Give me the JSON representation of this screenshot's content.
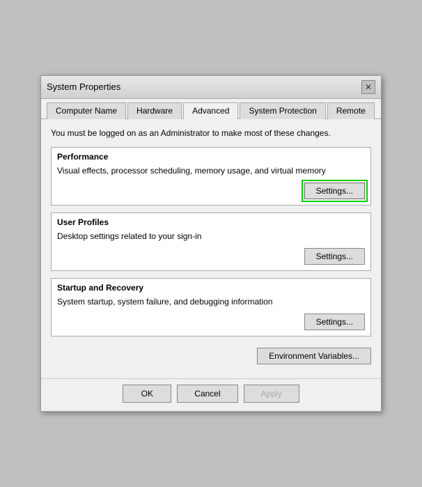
{
  "window": {
    "title": "System Properties",
    "close_label": "✕"
  },
  "tabs": [
    {
      "label": "Computer Name",
      "active": false
    },
    {
      "label": "Hardware",
      "active": false
    },
    {
      "label": "Advanced",
      "active": true
    },
    {
      "label": "System Protection",
      "active": false
    },
    {
      "label": "Remote",
      "active": false
    }
  ],
  "content": {
    "info_text": "You must be logged on as an Administrator to make most of these changes.",
    "performance": {
      "title": "Performance",
      "desc": "Visual effects, processor scheduling, memory usage, and virtual memory",
      "settings_label": "Settings..."
    },
    "user_profiles": {
      "title": "User Profiles",
      "desc": "Desktop settings related to your sign-in",
      "settings_label": "Settings..."
    },
    "startup_recovery": {
      "title": "Startup and Recovery",
      "desc": "System startup, system failure, and debugging information",
      "settings_label": "Settings..."
    },
    "env_variables_label": "Environment Variables...",
    "ok_label": "OK",
    "cancel_label": "Cancel",
    "apply_label": "Apply"
  }
}
